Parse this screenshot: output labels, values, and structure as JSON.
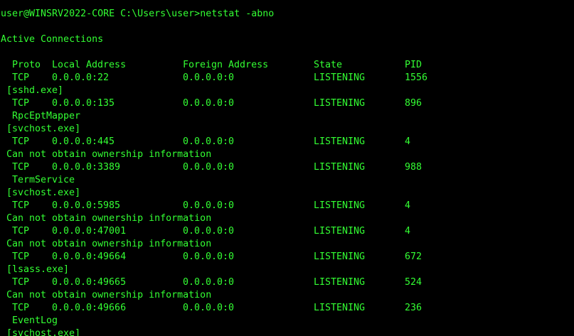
{
  "terminal": {
    "prompt": "user@WINSRV2022-CORE C:\\Users\\user>",
    "command": "netstat -abno",
    "section_title": "Active Connections",
    "text_color": "#33ff33",
    "background_color": "#000000"
  },
  "table": {
    "headers": {
      "proto": "Proto",
      "local": "Local Address",
      "foreign": "Foreign Address",
      "state": "State",
      "pid": "PID"
    },
    "entries": [
      {
        "proto": "TCP",
        "local": "0.0.0.0:22",
        "foreign": "0.0.0.0:0",
        "state": "LISTENING",
        "pid": "1556",
        "service": "",
        "process": "[sshd.exe]",
        "note": ""
      },
      {
        "proto": "TCP",
        "local": "0.0.0.0:135",
        "foreign": "0.0.0.0:0",
        "state": "LISTENING",
        "pid": "896",
        "service": "RpcEptMapper",
        "process": "[svchost.exe]",
        "note": ""
      },
      {
        "proto": "TCP",
        "local": "0.0.0.0:445",
        "foreign": "0.0.0.0:0",
        "state": "LISTENING",
        "pid": "4",
        "service": "",
        "process": "",
        "note": "Can not obtain ownership information"
      },
      {
        "proto": "TCP",
        "local": "0.0.0.0:3389",
        "foreign": "0.0.0.0:0",
        "state": "LISTENING",
        "pid": "988",
        "service": "TermService",
        "process": "[svchost.exe]",
        "note": ""
      },
      {
        "proto": "TCP",
        "local": "0.0.0.0:5985",
        "foreign": "0.0.0.0:0",
        "state": "LISTENING",
        "pid": "4",
        "service": "",
        "process": "",
        "note": "Can not obtain ownership information"
      },
      {
        "proto": "TCP",
        "local": "0.0.0.0:47001",
        "foreign": "0.0.0.0:0",
        "state": "LISTENING",
        "pid": "4",
        "service": "",
        "process": "",
        "note": "Can not obtain ownership information"
      },
      {
        "proto": "TCP",
        "local": "0.0.0.0:49664",
        "foreign": "0.0.0.0:0",
        "state": "LISTENING",
        "pid": "672",
        "service": "",
        "process": "[lsass.exe]",
        "note": ""
      },
      {
        "proto": "TCP",
        "local": "0.0.0.0:49665",
        "foreign": "0.0.0.0:0",
        "state": "LISTENING",
        "pid": "524",
        "service": "",
        "process": "",
        "note": "Can not obtain ownership information"
      },
      {
        "proto": "TCP",
        "local": "0.0.0.0:49666",
        "foreign": "0.0.0.0:0",
        "state": "LISTENING",
        "pid": "236",
        "service": "EventLog",
        "process": "[svchost.exe]",
        "note": ""
      }
    ]
  }
}
